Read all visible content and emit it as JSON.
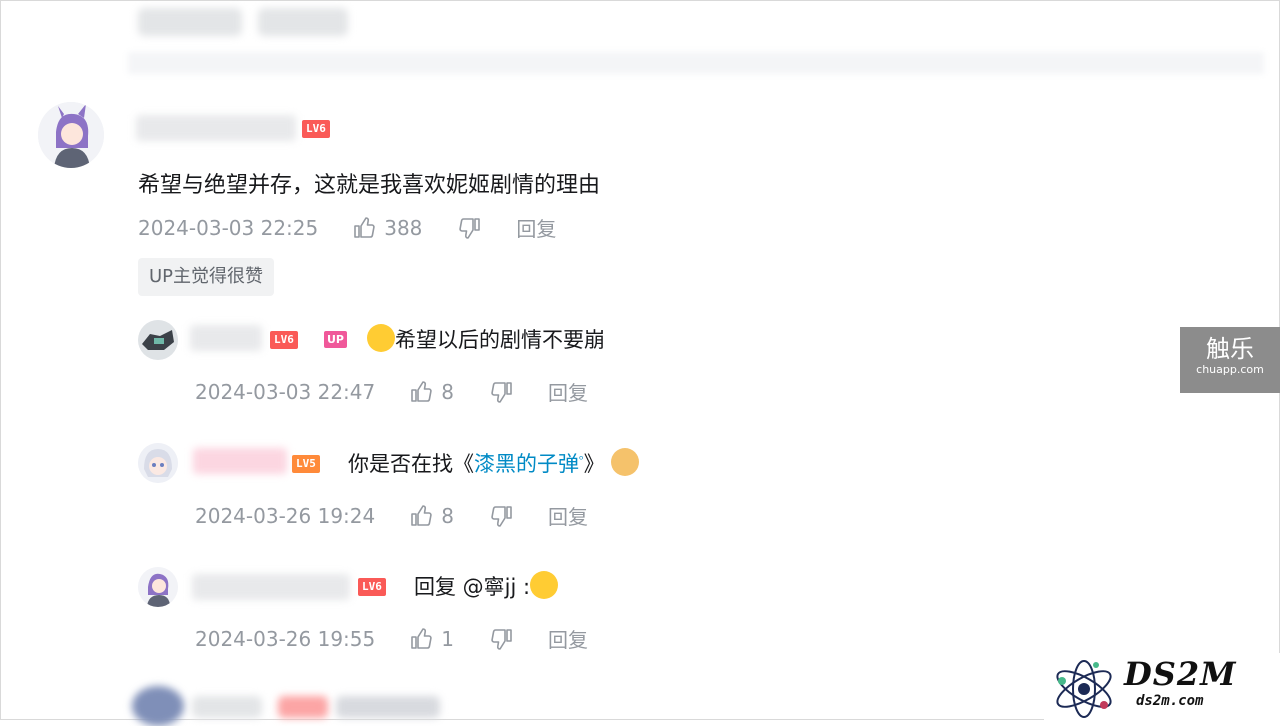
{
  "comment": {
    "level": "LV6",
    "text": "希望与绝望并存，这就是我喜欢妮姬剧情的理由",
    "date": "2024-03-03 22:25",
    "likes": "388",
    "reply_label": "回复",
    "badge": "UP主觉得很赞"
  },
  "replies": [
    {
      "level": "LV6",
      "up_tag": "UP",
      "text": "希望以后的剧情不要崩",
      "date": "2024-03-03 22:47",
      "likes": "8",
      "reply_label": "回复"
    },
    {
      "level": "LV5",
      "text_prefix": "你是否在找《",
      "link_text": "漆黑的子弹",
      "text_suffix": "》",
      "date": "2024-03-26 19:24",
      "likes": "8",
      "reply_label": "回复"
    },
    {
      "level": "LV6",
      "text": "回复 @寧jj :",
      "date": "2024-03-26 19:55",
      "likes": "1",
      "reply_label": "回复"
    }
  ],
  "watermark": {
    "title": "触乐",
    "subtitle": "chuapp.com"
  },
  "site_logo": {
    "title": "DS2M",
    "subtitle": "ds2m.com"
  },
  "icons": {
    "like": "thumb-up-icon",
    "dislike": "thumb-down-icon",
    "search": "search-icon"
  },
  "colors": {
    "level_red": "#fa5a57",
    "level_orange": "#ff8a3a",
    "up_pink": "#f0589a",
    "link": "#008ac5"
  }
}
